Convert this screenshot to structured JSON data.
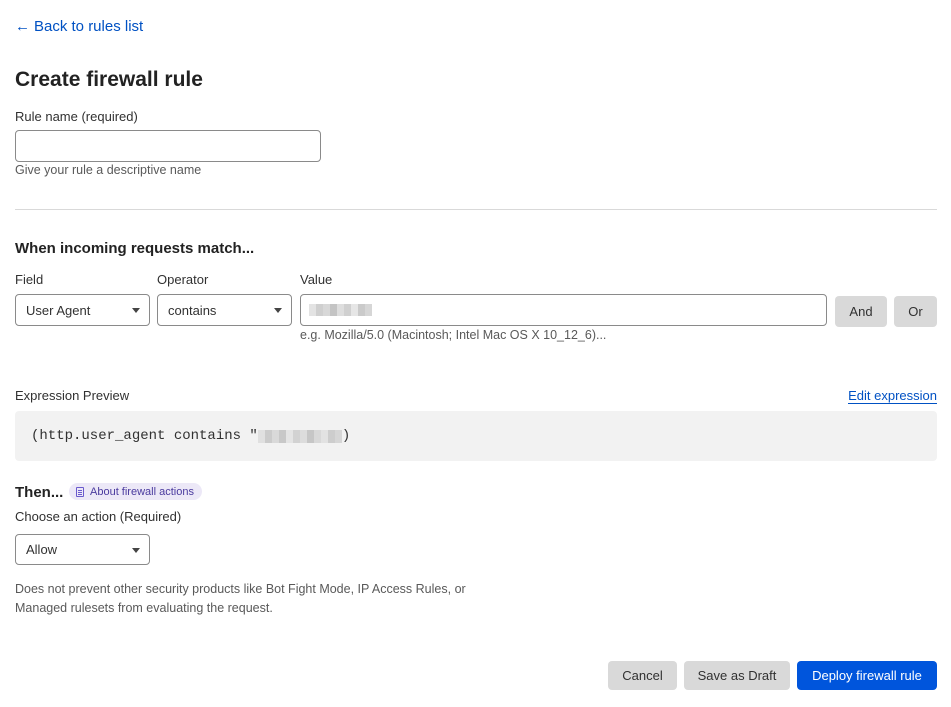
{
  "nav": {
    "back_label": "Back to rules list"
  },
  "page": {
    "title": "Create firewall rule"
  },
  "rule_name": {
    "label": "Rule name (required)",
    "value": "",
    "placeholder": "",
    "help": "Give your rule a descriptive name"
  },
  "match": {
    "title": "When incoming requests match...",
    "field_label": "Field",
    "operator_label": "Operator",
    "value_label": "Value",
    "field_value": "User Agent",
    "operator_value": "contains",
    "value_help": "e.g. Mozilla/5.0 (Macintosh; Intel Mac OS X 10_12_6)...",
    "and_label": "And",
    "or_label": "Or"
  },
  "expression": {
    "label": "Expression Preview",
    "edit_label": "Edit expression",
    "prefix": "(http.user_agent contains \"",
    "suffix": ")"
  },
  "action": {
    "then_label": "Then...",
    "about_label": "About firewall actions",
    "choose_label": "Choose an action (Required)",
    "selected": "Allow",
    "description": "Does not prevent other security products like Bot Fight Mode, IP Access Rules, or Managed rulesets from evaluating the request."
  },
  "footer": {
    "cancel_label": "Cancel",
    "draft_label": "Save as Draft",
    "deploy_label": "Deploy firewall rule"
  },
  "colors": {
    "link": "#0051c3",
    "primary_button": "#0055dc",
    "secondary_button": "#d9d9d9",
    "expression_bg": "#f2f2f2"
  }
}
